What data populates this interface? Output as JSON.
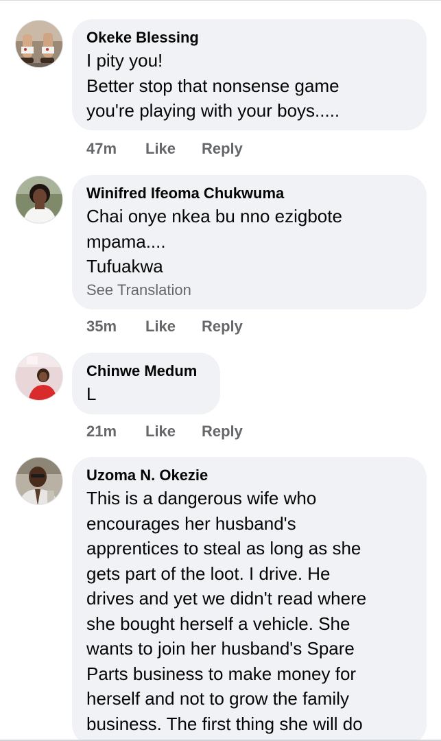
{
  "comments": [
    {
      "author": "Okeke Blessing",
      "lines": [
        "I pity you!",
        "Better stop that nonsense game",
        "you're playing  with your boys....."
      ],
      "see_translation": "",
      "time": "47m",
      "like": "Like",
      "reply": "Reply",
      "avatar": "avatar-photo-legs"
    },
    {
      "author": "Winifred Ifeoma Chukwuma",
      "lines": [
        "Chai onye nkea bu nno ezigbote",
        "mpama....",
        "Tufuakwa"
      ],
      "see_translation": "See Translation",
      "time": "35m",
      "like": "Like",
      "reply": "Reply",
      "avatar": "avatar-photo-woman-white"
    },
    {
      "author": "Chinwe Medum",
      "lines": [
        "L"
      ],
      "see_translation": "",
      "time": "21m",
      "like": "Like",
      "reply": "Reply",
      "avatar": "avatar-photo-woman-red"
    },
    {
      "author": "Uzoma N. Okezie",
      "lines": [
        "This is a dangerous wife who",
        "encourages her husband's",
        "apprentices to steal as long as she",
        "gets part of the loot. I drive. He",
        "drives and yet we didn't read where",
        "she bought herself a vehicle. She",
        "wants to join her husband's Spare",
        "Parts business to make money for",
        "herself and not to grow the family",
        "business.  The first thing she will do"
      ],
      "see_translation": "",
      "time": "",
      "like": "",
      "reply": "",
      "avatar": "avatar-photo-man-suit"
    }
  ],
  "colors": {
    "bubble": "#f0f2f5",
    "text": "#050505",
    "secondary": "#65676b"
  }
}
